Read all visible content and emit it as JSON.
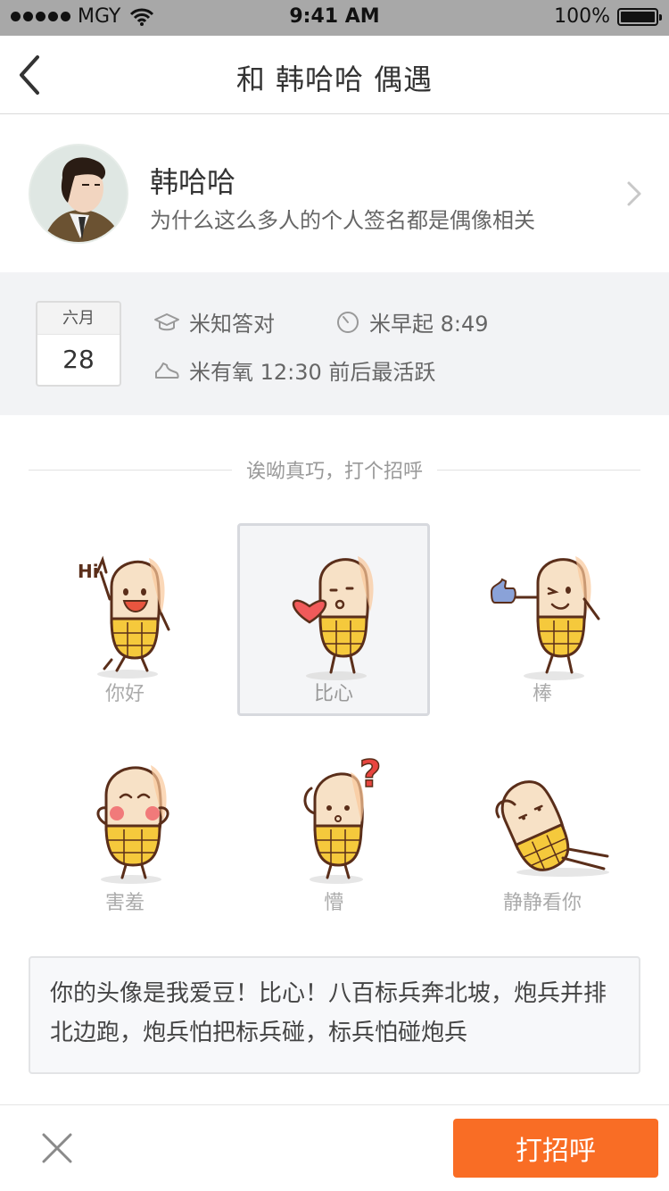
{
  "status_bar": {
    "carrier": "MGY",
    "time": "9:41 AM",
    "battery": "100%"
  },
  "nav": {
    "title": "和 韩哈哈 偶遇",
    "back_icon": "chevron-left-icon"
  },
  "profile": {
    "name": "韩哈哈",
    "signature": "为什么这么多人的个人签名都是偶像相关",
    "chevron_icon": "chevron-right-icon"
  },
  "info": {
    "calendar": {
      "month": "六月",
      "day": "28"
    },
    "items": [
      {
        "icon": "graduation-cap-icon",
        "text": "米知答对"
      },
      {
        "icon": "clock-icon",
        "text": "米早起 8:49"
      },
      {
        "icon": "shoe-icon",
        "text": "米有氧 12:30 前后最活跃"
      }
    ]
  },
  "greeting_title": "诶呦真巧，打个招呼",
  "stickers": [
    {
      "label": "你好",
      "selected": false
    },
    {
      "label": "比心",
      "selected": true
    },
    {
      "label": "棒",
      "selected": false
    },
    {
      "label": "害羞",
      "selected": false
    },
    {
      "label": "懵",
      "selected": false
    },
    {
      "label": "静静看你",
      "selected": false
    }
  ],
  "sticker_texts": {
    "hi": "Hi",
    "question": "?"
  },
  "message": "你的头像是我爱豆！比心！八百标兵奔北坡，炮兵并排北边跑，炮兵怕把标兵碰，标兵怕碰炮兵",
  "bottom": {
    "close_icon": "close-icon",
    "cta_label": "打招呼"
  },
  "colors": {
    "accent": "#f96d25",
    "sticker_body": "#f7e1c6",
    "sticker_pants": "#f5c93c",
    "outline": "#5a2e1a",
    "heart": "#f15a5a"
  }
}
